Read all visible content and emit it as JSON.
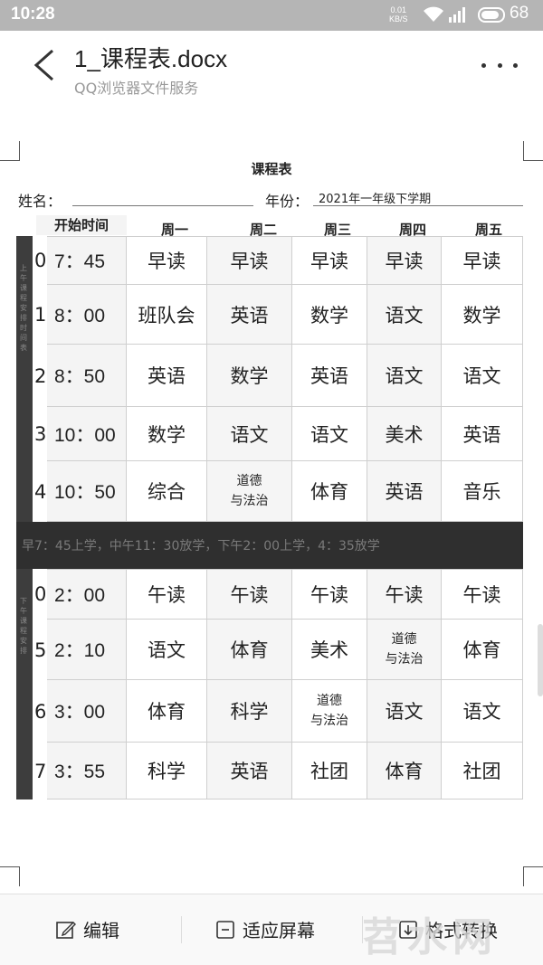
{
  "status": {
    "time": "10:28",
    "net_speed": "0.01",
    "net_unit": "KB/S",
    "signal": "4G",
    "battery": "68"
  },
  "header": {
    "title": "1_课程表.docx",
    "subtitle": "QQ浏览器文件服务"
  },
  "doc": {
    "title": "课程表",
    "name_label": "姓名：",
    "year_label": "年份：",
    "year_value": "2021年一年级下学期",
    "start_time_label": "开始时间",
    "days": [
      "周一",
      "周二",
      "周三",
      "周四",
      "周五"
    ],
    "morning_side": "上午课程安排时间表",
    "afternoon_side": "下午课程安排",
    "morning": [
      {
        "n": "0",
        "time": "7：45",
        "c": [
          "早读",
          "早读",
          "早读",
          "早读",
          "早读"
        ]
      },
      {
        "n": "1",
        "time": "8：00",
        "c": [
          "班队会",
          "英语",
          "数学",
          "语文",
          "数学"
        ]
      },
      {
        "n": "2",
        "time": "8：50",
        "c": [
          "英语",
          "数学",
          "英语",
          "语文",
          "语文"
        ]
      },
      {
        "n": "3",
        "time": "10：00",
        "c": [
          "数学",
          "语文",
          "语文",
          "美术",
          "英语"
        ]
      },
      {
        "n": "4",
        "time": "10：50",
        "c": [
          "综合",
          "道德\n与法治",
          "体育",
          "英语",
          "音乐"
        ]
      }
    ],
    "note": "早7：45上学，中午11：30放学，下午2：00上学，4：35放学",
    "afternoon": [
      {
        "n": "0",
        "time": "2：00",
        "c": [
          "午读",
          "午读",
          "午读",
          "午读",
          "午读"
        ]
      },
      {
        "n": "5",
        "time": "2：10",
        "c": [
          "语文",
          "体育",
          "美术",
          "道德\n与法治",
          "体育"
        ]
      },
      {
        "n": "6",
        "time": "3：00",
        "c": [
          "体育",
          "科学",
          "道德\n与法治",
          "语文",
          "语文"
        ]
      },
      {
        "n": "7",
        "time": "3：55",
        "c": [
          "科学",
          "英语",
          "社团",
          "体育",
          "社团"
        ]
      }
    ]
  },
  "toolbar": {
    "edit": "编辑",
    "fit": "适应屏幕",
    "convert": "格式转换"
  },
  "watermark": "苕水网"
}
